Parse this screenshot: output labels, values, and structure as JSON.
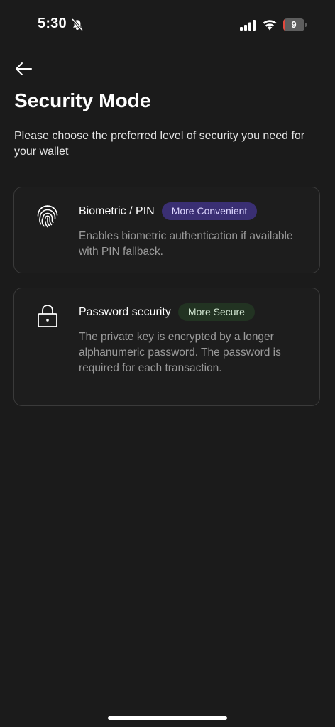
{
  "status_bar": {
    "time": "5:30",
    "battery_level": "9",
    "battery_color": "#e2483d",
    "icons": [
      "bell-slash-icon",
      "signal-icon",
      "wifi-icon",
      "battery-icon"
    ]
  },
  "header": {
    "back_icon": "arrow-left-icon",
    "title": "Security Mode",
    "description": "Please choose the preferred level of security you need for your wallet"
  },
  "options": [
    {
      "icon": "fingerprint-icon",
      "title": "Biometric / PIN",
      "badge": "More Convenient",
      "badge_color": "#3a2f73",
      "description": "Enables biometric authentication if available with PIN fallback."
    },
    {
      "icon": "lock-icon",
      "title": "Password security",
      "badge": "More Secure",
      "badge_color": "#223322",
      "description": "The private key is encrypted by a longer alphanumeric password. The password is required for each transaction."
    }
  ],
  "colors": {
    "background": "#1b1b1b",
    "card_border": "#3a3a3a",
    "secondary_text": "#9a9a9a"
  }
}
